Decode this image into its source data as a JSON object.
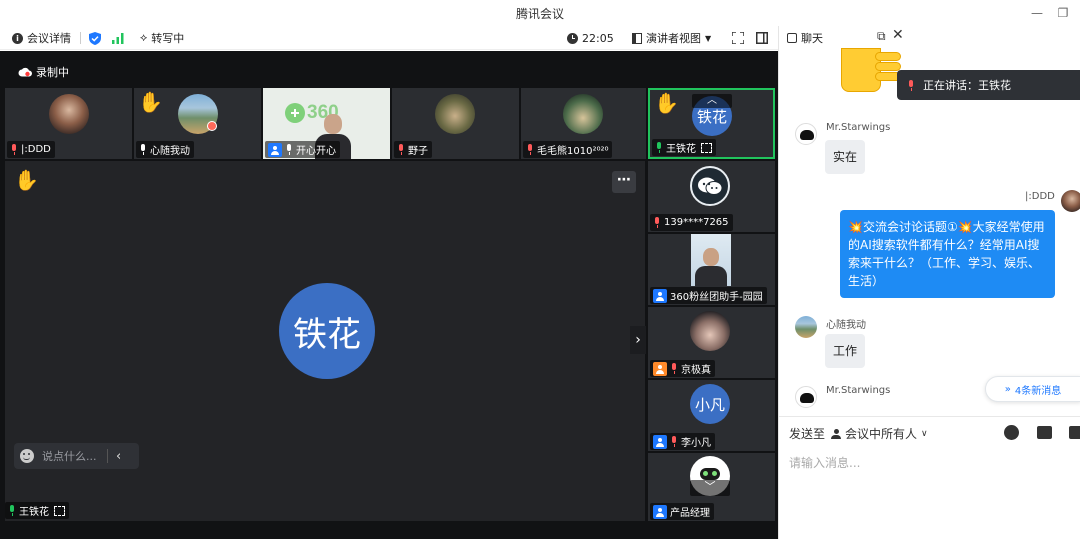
{
  "window": {
    "title": "腾讯会议",
    "minimize_glyph": "—",
    "maximize_glyph": "❐"
  },
  "toolbar": {
    "meeting_details": "会议详情",
    "transcribing": "转写中",
    "time": "22:05",
    "view_mode": "演讲者视图"
  },
  "recording": {
    "label": "录制中"
  },
  "top_tiles": [
    {
      "name": "|:DDD",
      "mic": "red"
    },
    {
      "name": "心随我动",
      "mic": "red"
    },
    {
      "name": "开心开心",
      "mic": "white",
      "logo_text": "360"
    },
    {
      "name": "野子",
      "mic": "red"
    },
    {
      "name": "毛毛熊1010²⁰²⁰",
      "mic": "red"
    },
    {
      "name": "王铁花",
      "mic": "green",
      "avatar_text": "铁花"
    }
  ],
  "main_speaker": {
    "avatar_text": "铁花",
    "name": "王铁花",
    "accent": "#3b6fc4"
  },
  "side_tiles": [
    {
      "name": "139****7265",
      "mic": "red"
    },
    {
      "name": "360粉丝团助手-园园",
      "mic": "none"
    },
    {
      "name": "京极真",
      "mic": "red"
    },
    {
      "name": "李小凡",
      "mic": "red",
      "avatar_text": "小凡"
    },
    {
      "name": "产品经理",
      "mic": "none"
    }
  ],
  "input_overlay": {
    "placeholder": "说点什么..."
  },
  "chat": {
    "header_label": "聊天",
    "speaking_label": "正在讲话：王铁花",
    "messages": [
      {
        "sender": "Mr.Starwings",
        "text": "实在"
      },
      {
        "sender": "|:DDD",
        "text": "💥交流会讨论话题①💥大家经常使用的AI搜索软件都有什么？经常用AI搜索来干什么？（工作、学习、娱乐、生活）"
      },
      {
        "sender": "心随我动",
        "text": "工作"
      },
      {
        "sender": "Mr.Starwings",
        "text": ""
      }
    ],
    "new_messages": "4条新消息",
    "send_to_label": "发送至",
    "send_to_target": "会议中所有人",
    "input_placeholder": "请输入消息..."
  },
  "colors": {
    "accent_blue": "#1e78ff",
    "speaker_border": "#21c45d",
    "dark_bg": "#111214"
  }
}
